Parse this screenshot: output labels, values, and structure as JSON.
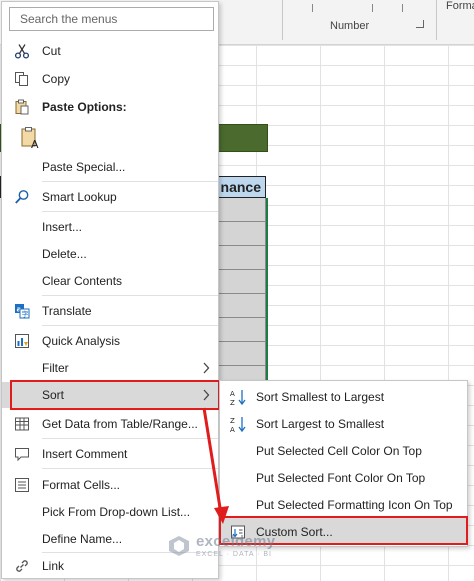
{
  "background": {
    "ribbon_group_label": "Number",
    "ribbon_next_label": "Forma",
    "header_cell_text": "nance"
  },
  "search": {
    "placeholder": "Search the menus"
  },
  "menu": {
    "items": [
      {
        "label": "Cut",
        "icon": "scissors-icon"
      },
      {
        "label": "Copy",
        "icon": "copy-icon"
      },
      {
        "label": "Paste Options:",
        "icon": "clipboard-icon"
      },
      {
        "label": "",
        "icon": "paste-icon"
      },
      {
        "label": "Paste Special...",
        "icon": ""
      },
      {
        "label": "Smart Lookup",
        "icon": "search-icon"
      },
      {
        "label": "Insert...",
        "icon": ""
      },
      {
        "label": "Delete...",
        "icon": ""
      },
      {
        "label": "Clear Contents",
        "icon": ""
      },
      {
        "label": "Translate",
        "icon": "translate-icon"
      },
      {
        "label": "Quick Analysis",
        "icon": "quick-analysis-icon"
      },
      {
        "label": "Filter",
        "icon": ""
      },
      {
        "label": "Sort",
        "icon": ""
      },
      {
        "label": "Get Data from Table/Range...",
        "icon": "table-icon"
      },
      {
        "label": "Insert Comment",
        "icon": "comment-icon"
      },
      {
        "label": "Format Cells...",
        "icon": "format-cells-icon"
      },
      {
        "label": "Pick From Drop-down List...",
        "icon": ""
      },
      {
        "label": "Define Name...",
        "icon": ""
      },
      {
        "label": "Link",
        "icon": "link-icon"
      }
    ]
  },
  "sort_submenu": {
    "items": [
      {
        "label": "Sort Smallest to Largest",
        "icon": "sort-ascending-icon"
      },
      {
        "label": "Sort Largest to Smallest",
        "icon": "sort-descending-icon"
      },
      {
        "label": "Put Selected Cell Color On Top",
        "icon": ""
      },
      {
        "label": "Put Selected Font Color On Top",
        "icon": ""
      },
      {
        "label": "Put Selected Formatting Icon On Top",
        "icon": ""
      },
      {
        "label": "Custom Sort...",
        "icon": "custom-sort-icon"
      }
    ]
  },
  "watermark": {
    "name": "exceldemy",
    "tagline": "EXCEL · DATA · BI"
  },
  "colors": {
    "highlight_box": "#e01c1c",
    "hover_bg": "#d9d9d9",
    "header_fill": "#bdd7ee",
    "title_bar_fill": "#4a6a2e"
  }
}
